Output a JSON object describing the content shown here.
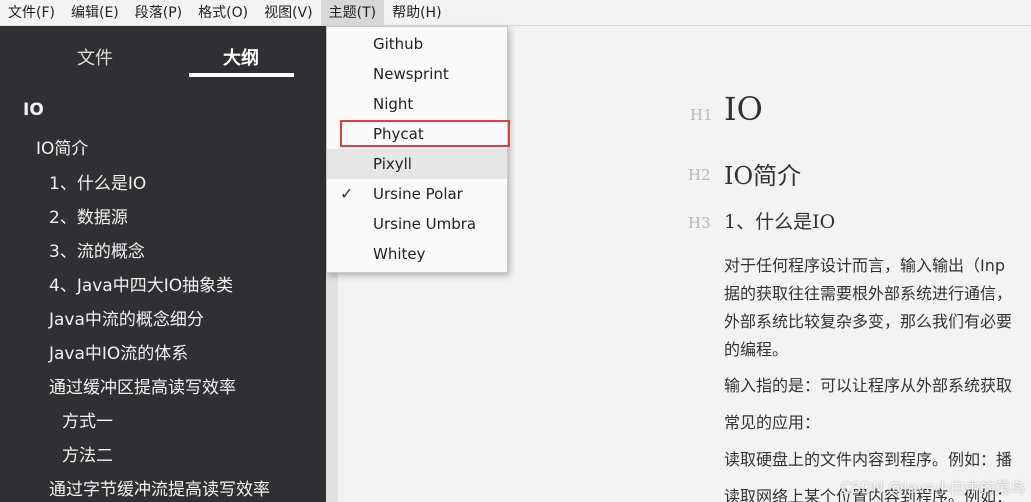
{
  "menubar": {
    "items": [
      "文件(F)",
      "编辑(E)",
      "段落(P)",
      "格式(O)",
      "视图(V)",
      "主题(T)",
      "帮助(H)"
    ]
  },
  "sidebar": {
    "tab_files": "文件",
    "tab_outline": "大纲",
    "outline": [
      "IO",
      "IO简介",
      "1、什么是IO",
      "2、数据源",
      "3、流的概念",
      "4、Java中四大IO抽象类",
      "Java中流的概念细分",
      "Java中IO流的体系",
      "通过缓冲区提高读写效率",
      "方式一",
      "方法二",
      "通过字节缓冲流提高读写效率"
    ]
  },
  "theme_menu": {
    "items": [
      "Github",
      "Newsprint",
      "Night",
      "Phycat",
      "Pixyll",
      "Ursine Polar",
      "Ursine Umbra",
      "Whitey"
    ],
    "checked": "Ursine Polar",
    "hovered": "Pixyll",
    "boxed": "Phycat",
    "check_glyph": "✓",
    "highlight_color": "#e0403a"
  },
  "editor": {
    "h1_marker": "H1",
    "h1": "IO",
    "h2_marker": "H2",
    "h2": "IO简介",
    "h3_marker": "H3",
    "h3": "1、什么是IO",
    "paragraphs": [
      "对于任何程序设计而言，输入输出（Inp",
      "据的获取往往需要根外部系统进行通信，",
      "外部系统比较复杂多变，那么我们有必要",
      "的编程。",
      "输入指的是：可以让程序从外部系统获取",
      "常见的应用：",
      "读取硬盘上的文件内容到程序。例如：播",
      "读取网络上某个位置内容到程序。例如："
    ],
    "watermark": "CSDN @Java小白中的菜鸟"
  },
  "colors": {
    "sidebar_bg": "#2e3033",
    "editor_bg": "#f3f3f3",
    "menu_bg": "#fafafa"
  }
}
